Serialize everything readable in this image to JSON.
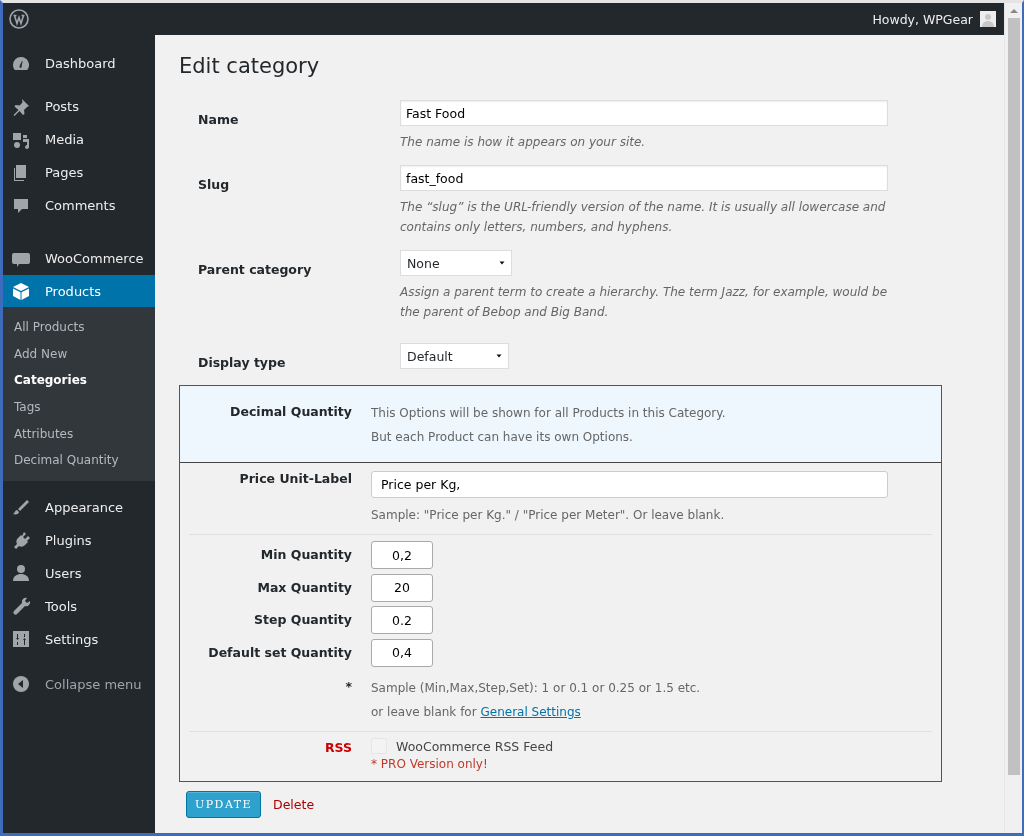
{
  "admin_bar": {
    "greeting": "Howdy, WPGear"
  },
  "sidebar": {
    "groups": [
      [
        {
          "label": "Dashboard",
          "selected": false
        }
      ],
      [
        {
          "label": "Posts",
          "selected": false
        },
        {
          "label": "Media",
          "selected": false
        },
        {
          "label": "Pages",
          "selected": false
        },
        {
          "label": "Comments",
          "selected": false
        }
      ],
      [
        {
          "label": "WooCommerce",
          "selected": false
        },
        {
          "label": "Products",
          "selected": true,
          "children": [
            {
              "label": "All Products",
              "selected": false
            },
            {
              "label": "Add New",
              "selected": false
            },
            {
              "label": "Categories",
              "selected": true
            },
            {
              "label": "Tags",
              "selected": false
            },
            {
              "label": "Attributes",
              "selected": false
            },
            {
              "label": "Decimal Quantity",
              "selected": false
            }
          ]
        }
      ],
      [
        {
          "label": "Appearance",
          "selected": false
        },
        {
          "label": "Plugins",
          "selected": false
        },
        {
          "label": "Users",
          "selected": false
        },
        {
          "label": "Tools",
          "selected": false
        },
        {
          "label": "Settings",
          "selected": false
        }
      ]
    ],
    "collapse_label": "Collapse menu"
  },
  "page_title": "Edit category",
  "fields": [
    {
      "kind": "text",
      "label": "Name",
      "value": "Fast Food",
      "description": "The name is how it appears on your site."
    },
    {
      "kind": "text",
      "label": "Slug",
      "value": "fast_food",
      "description": "The “slug” is the URL-friendly version of the name. It is usually all lowercase and contains only letters, numbers, and hyphens."
    },
    {
      "kind": "select",
      "label": "Parent category",
      "value": "None",
      "description": "Assign a parent term to create a hierarchy. The term Jazz, for example, would be the parent of Bebop and Big Band."
    },
    {
      "kind": "select",
      "label": "Display type",
      "value": "Default"
    }
  ],
  "decimal_panel": {
    "title": "Decimal Quantity",
    "intro": [
      "This Options will be shown for all Products in this Category.",
      "But each Product can have its own Options."
    ],
    "unit_label": {
      "label": "Price Unit-Label",
      "value": "Price per Kg,",
      "hint": "Sample: \"Price per Kg.\" / \"Price per Meter\". Or leave blank."
    },
    "quantities": [
      {
        "label": "Min Quantity",
        "value": "0,2"
      },
      {
        "label": "Max Quantity",
        "value": "20"
      },
      {
        "label": "Step Quantity",
        "value": "0.2"
      },
      {
        "label": "Default set Quantity",
        "value": "0,4"
      }
    ],
    "note_mark": "*",
    "note": "Sample (Min,Max,Step,Set): 1 or 0.1 or 0.25 or 1.5 etc.",
    "note_prefix": "or leave blank for",
    "note_link": "General Settings",
    "rss": {
      "label": "RSS",
      "option": "WooCommerce RSS Feed",
      "checked": false,
      "pro_note": "* PRO Version only!"
    }
  },
  "buttons": {
    "update": "UPDATE",
    "delete": "Delete"
  }
}
